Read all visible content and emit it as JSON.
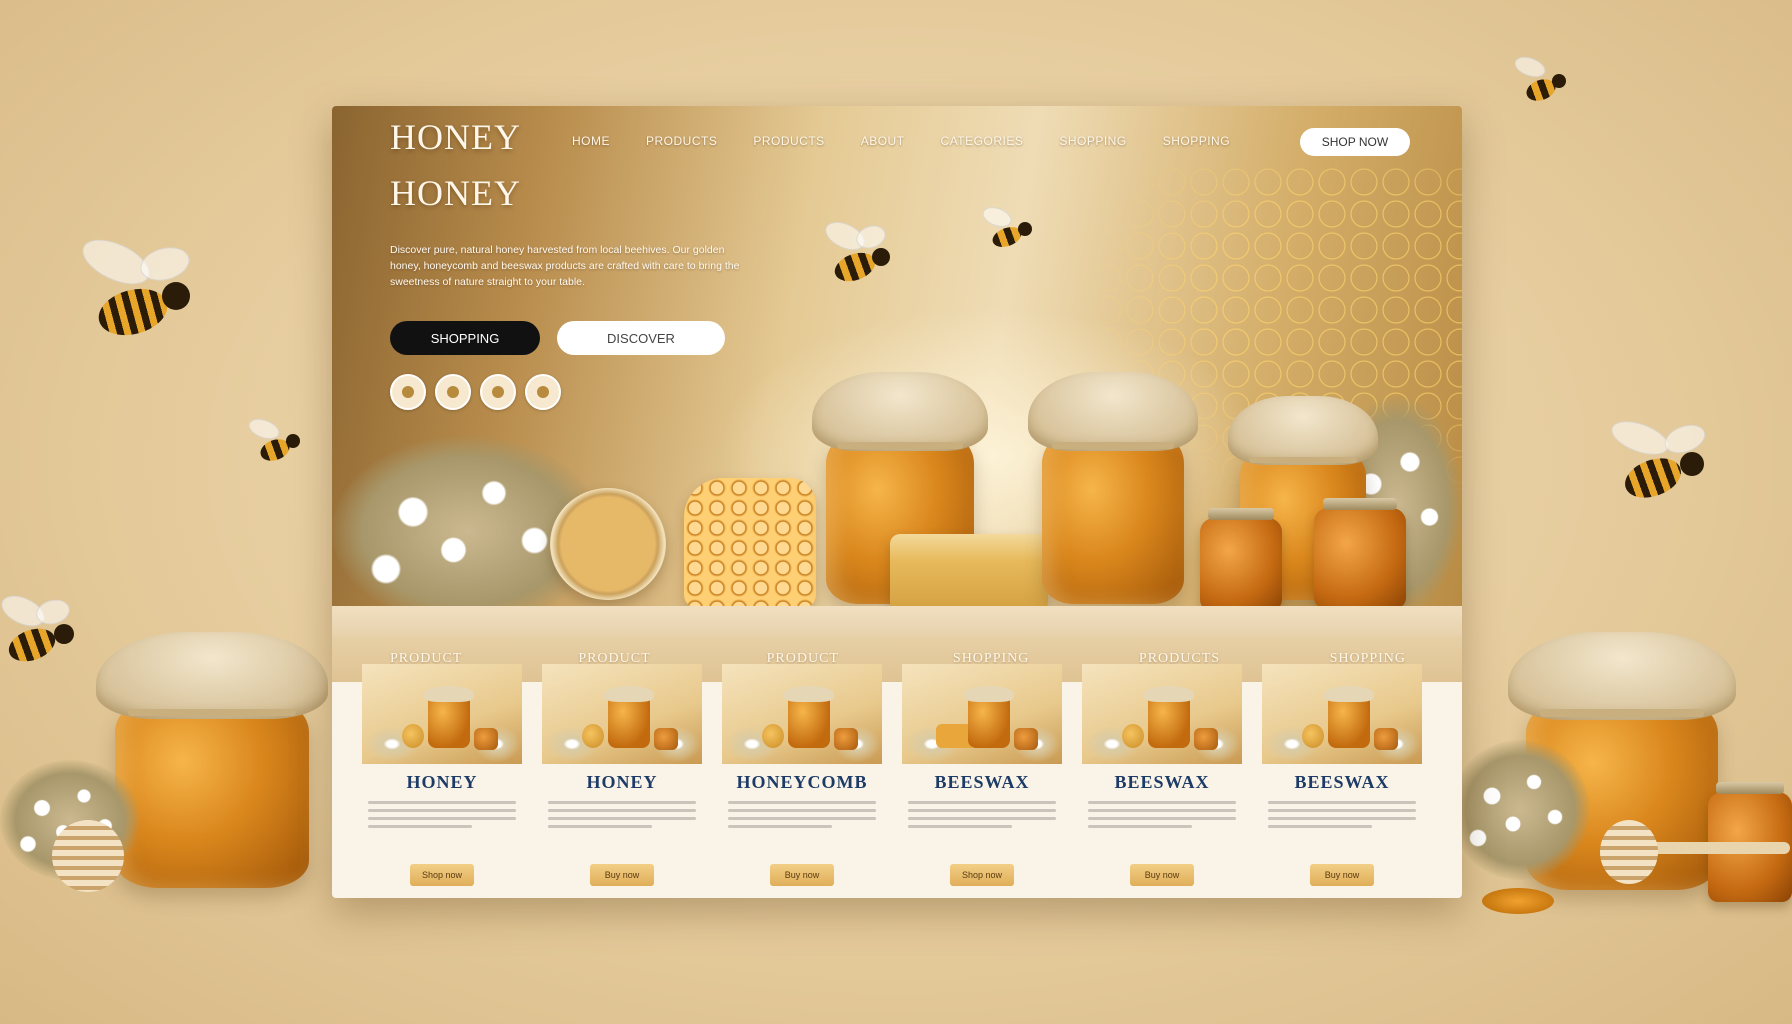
{
  "header": {
    "logo_line1": "HONEY",
    "logo_line2": "HONEY",
    "nav": [
      "HOME",
      "PRODUCTS",
      "PRODUCTS",
      "ABOUT",
      "CATEGORIES",
      "SHOPPING",
      "SHOPPING"
    ],
    "nav_button": "SHOP NOW"
  },
  "hero": {
    "description": "Discover pure, natural honey harvested from local beehives. Our golden honey, honeycomb and beeswax products are crafted with care to bring the sweetness of nature straight to your table.",
    "primary_button": "SHOPPING",
    "secondary_button": "DISCOVER",
    "slider_dots": 4
  },
  "categories": [
    "PRODUCT",
    "PRODUCT",
    "PRODUCT",
    "SHOPPING",
    "PRODUCTS",
    "SHOPPING"
  ],
  "products": [
    {
      "name": "HONEY",
      "button": "Shop now"
    },
    {
      "name": "HONEY",
      "button": "Buy now"
    },
    {
      "name": "HONEYCOMB",
      "button": "Buy now"
    },
    {
      "name": "BEESWAX",
      "button": "Shop now"
    },
    {
      "name": "BEESWAX",
      "button": "Buy now"
    },
    {
      "name": "BEESWAX",
      "button": "Buy now"
    }
  ],
  "colors": {
    "accent": "#d9861c",
    "dark_button": "#111111",
    "product_title": "#1d3b66",
    "buy_button": "#e0ae59"
  }
}
